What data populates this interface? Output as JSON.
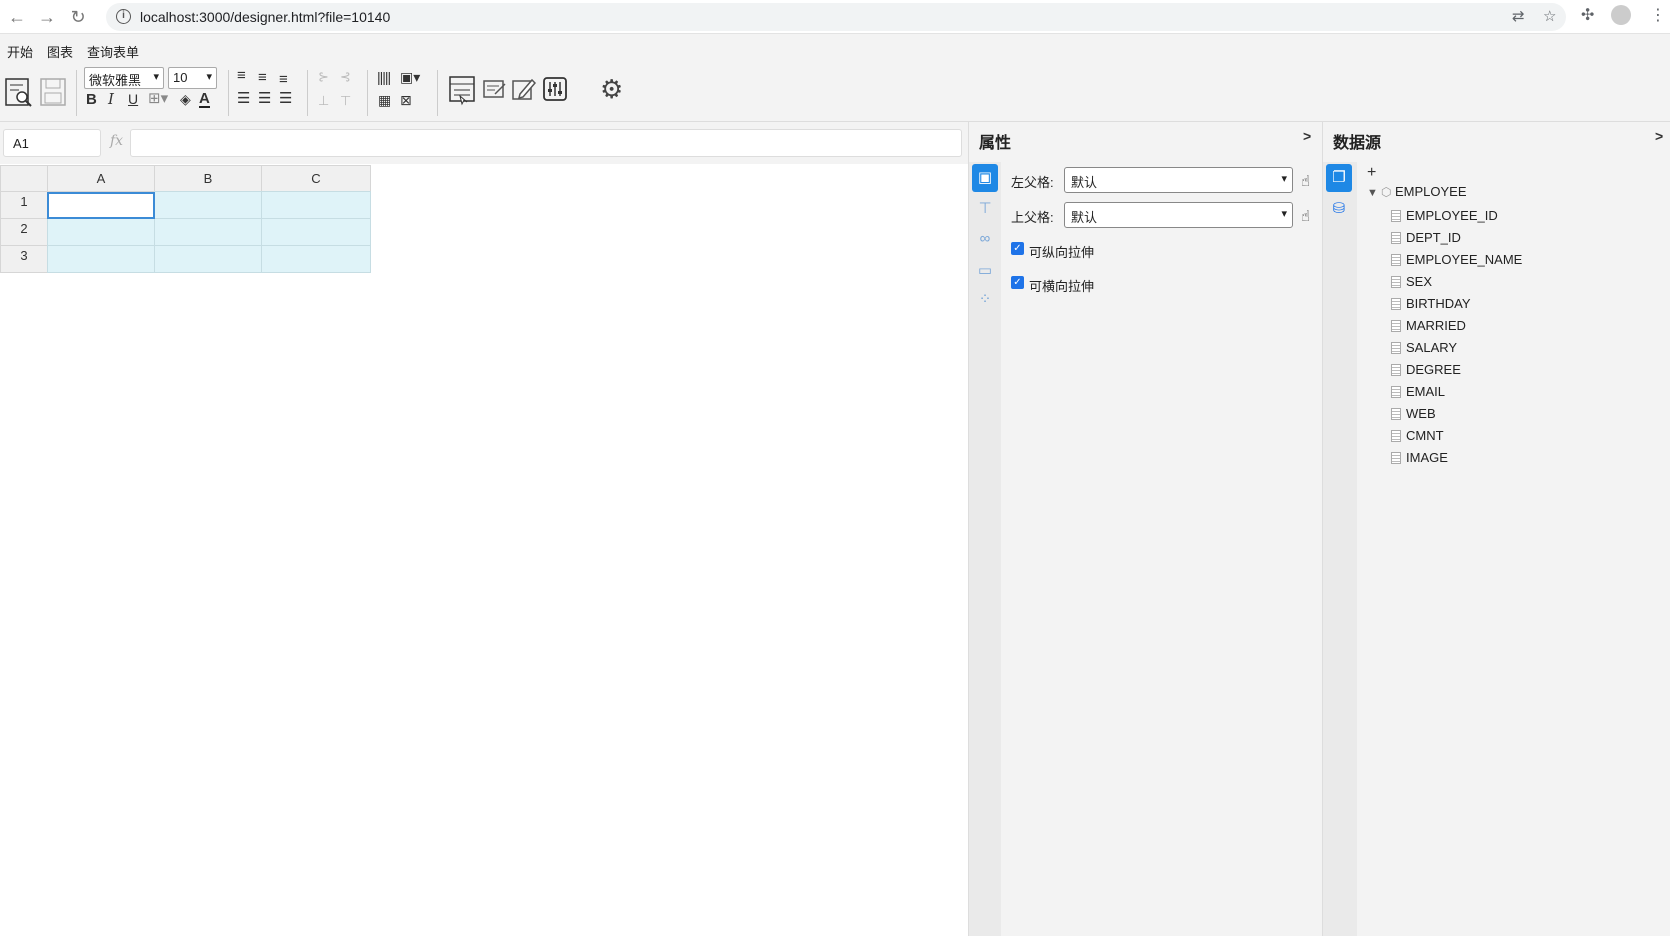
{
  "browser": {
    "url": "localhost:3000/designer.html?file=10140"
  },
  "menu": {
    "tabs": [
      {
        "label": "开始",
        "active": true
      },
      {
        "label": "图表",
        "active": false
      },
      {
        "label": "查询表单",
        "active": false
      }
    ]
  },
  "toolbar": {
    "font_family": "微软雅黑",
    "font_size": "10",
    "bold": "B",
    "italic": "I",
    "underline": "U",
    "font_color": "A"
  },
  "formula_bar": {
    "cell_ref": "A1",
    "fx": "fx",
    "formula": ""
  },
  "grid": {
    "columns": [
      "A",
      "B",
      "C"
    ],
    "rows": [
      "1",
      "2",
      "3"
    ],
    "selected": "A1"
  },
  "properties": {
    "title": "属性",
    "collapse": ">",
    "left_parent_label": "左父格:",
    "left_parent_value": "默认",
    "top_parent_label": "上父格:",
    "top_parent_value": "默认",
    "vertical_stretch_label": "可纵向拉伸",
    "vertical_stretch_checked": true,
    "horizontal_stretch_label": "可横向拉伸",
    "horizontal_stretch_checked": true
  },
  "datasource": {
    "title": "数据源",
    "collapse": ">",
    "add": "+",
    "dataset": "EMPLOYEE",
    "fields": [
      "EMPLOYEE_ID",
      "DEPT_ID",
      "EMPLOYEE_NAME",
      "SEX",
      "BIRTHDAY",
      "MARRIED",
      "SALARY",
      "DEGREE",
      "EMAIL",
      "WEB",
      "CMNT",
      "IMAGE"
    ]
  },
  "colors": {
    "accent": "#1e88e5",
    "cell_fill": "#dff3f8",
    "selection": "#3b8bd6"
  }
}
